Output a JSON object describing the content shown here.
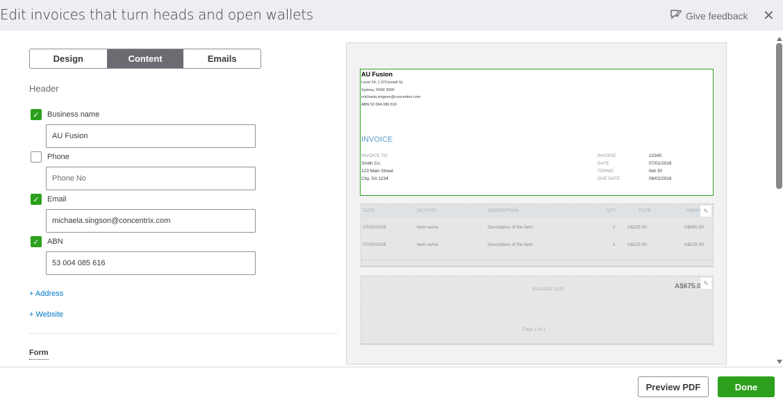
{
  "header": {
    "title": "Edit invoices that turn heads and open wallets",
    "feedback": "Give feedback",
    "close": "✕"
  },
  "tabs": [
    {
      "label": "Design"
    },
    {
      "label": "Content",
      "active": true
    },
    {
      "label": "Emails"
    }
  ],
  "section": "Header",
  "fields": [
    {
      "label": "Business name",
      "checked": true,
      "value": "AU Fusion",
      "placeholder": ""
    },
    {
      "label": "Phone",
      "checked": false,
      "value": "",
      "placeholder": "Phone No"
    },
    {
      "label": "Email",
      "checked": true,
      "value": "michaela.singson@concentrix.com",
      "placeholder": ""
    },
    {
      "label": "ABN",
      "checked": true,
      "value": "53 004 085 616",
      "placeholder": ""
    }
  ],
  "links": {
    "address": "+ Address",
    "website": "+ Website"
  },
  "form_label": "Form",
  "preview": {
    "business": "AU Fusion",
    "address_lines": [
      "Level 34, 1 O'Connell St.",
      "Sydney, NSW 2000",
      "michaela.singson@concentrix.com",
      "ABN 53 004 085 616"
    ],
    "invoice_title": "INVOICE",
    "invoice_to_label": "INVOICE TO",
    "invoice_to": [
      "Smith Co.",
      "123 Main Street",
      "City, SA 1234"
    ],
    "meta": [
      {
        "k": "INVOICE",
        "v": "12345"
      },
      {
        "k": "DATE",
        "v": "07/01/2018"
      },
      {
        "k": "TERMS",
        "v": "Net 30"
      },
      {
        "k": "DUE DATE",
        "v": "06/02/2018"
      }
    ],
    "columns": [
      "DATE",
      "ACTIVITY",
      "DESCRIPTION",
      "QTY",
      "RATE",
      "AMOUNT"
    ],
    "rows": [
      [
        "07/01/2018",
        "Item name",
        "Description of the item",
        "2",
        "A$225.00",
        "A$450.00"
      ],
      [
        "07/01/2018",
        "Item name",
        "Description of the item",
        "1",
        "A$225.00",
        "A$225.00"
      ]
    ],
    "balance_label": "BALANCE DUE",
    "balance": "A$675.00",
    "page": "Page 1 of 1"
  },
  "footer": {
    "preview_pdf": "Preview PDF",
    "done": "Done"
  },
  "colors": {
    "accent": "#2ca01c",
    "link": "#0077c5",
    "invoice": "#5a9bcb"
  }
}
